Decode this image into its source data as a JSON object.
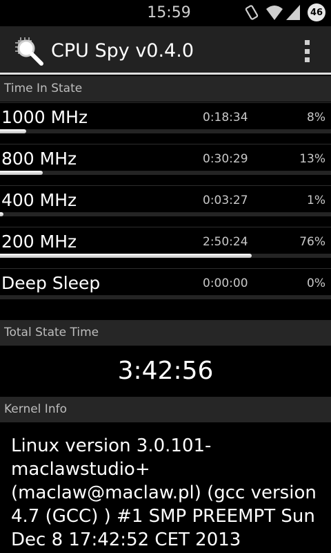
{
  "status_bar": {
    "time": "15:59",
    "icons": [
      "vibrate-icon",
      "wifi-icon",
      "signal-icon"
    ],
    "badge": "46"
  },
  "app_bar": {
    "title": "CPU Spy v0.4.0",
    "icon": "magnifier-chip-icon",
    "menu_icon": "overflow-menu-icon"
  },
  "time_in_state": {
    "header": "Time In State",
    "states": [
      {
        "freq": "1000 MHz",
        "duration": "0:18:34",
        "percent": "8%",
        "fraction": 0.08
      },
      {
        "freq": "800 MHz",
        "duration": "0:30:29",
        "percent": "13%",
        "fraction": 0.13
      },
      {
        "freq": "400 MHz",
        "duration": "0:03:27",
        "percent": "1%",
        "fraction": 0.01
      },
      {
        "freq": "200 MHz",
        "duration": "2:50:24",
        "percent": "76%",
        "fraction": 0.76
      },
      {
        "freq": "Deep Sleep",
        "duration": "0:00:00",
        "percent": "0%",
        "fraction": 0.0
      }
    ]
  },
  "total_state_time": {
    "header": "Total State Time",
    "value": "3:42:56"
  },
  "kernel_info": {
    "header": "Kernel Info",
    "text": "Linux version 3.0.101-maclawstudio+ (maclaw@maclaw.pl) (gcc version 4.7 (GCC) ) #1 SMP PREEMPT Sun Dec 8 17:42:52 CET 2013"
  }
}
